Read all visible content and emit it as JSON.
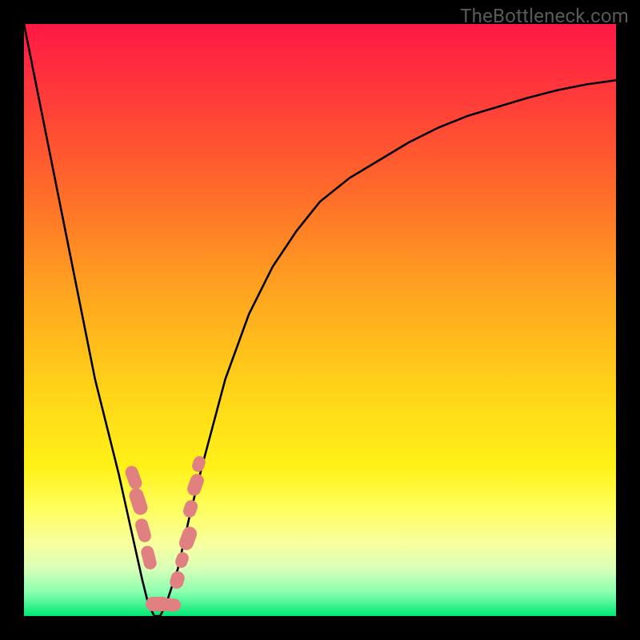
{
  "watermark": "TheBottleneck.com",
  "colors": {
    "frame": "#000000",
    "gradient_top": "#ff1844",
    "gradient_bottom": "#00e874",
    "curve": "#000000",
    "bead": "#e08080"
  },
  "chart_data": {
    "type": "line",
    "title": "",
    "xlabel": "",
    "ylabel": "",
    "xlim": [
      0,
      100
    ],
    "ylim": [
      0,
      100
    ],
    "x": [
      0,
      2,
      4,
      6,
      8,
      10,
      12,
      14,
      16,
      18,
      20,
      21,
      22,
      23,
      24,
      26,
      28,
      30,
      34,
      38,
      42,
      46,
      50,
      55,
      60,
      65,
      70,
      75,
      80,
      85,
      90,
      95,
      100
    ],
    "values": [
      100,
      90,
      80,
      70,
      60,
      50,
      40,
      32,
      24,
      15,
      6,
      2,
      0,
      0,
      2,
      8,
      17,
      25,
      40,
      51,
      59,
      65,
      70,
      74,
      77,
      80,
      82.5,
      84.5,
      86,
      87.5,
      88.8,
      89.8,
      90.5
    ],
    "minimum_x": 22.5,
    "annotations": [
      {
        "type": "bead_cluster",
        "approx_x_range": [
          18,
          27
        ],
        "approx_y_range": [
          0,
          25
        ]
      }
    ],
    "legend": [],
    "grid": false
  }
}
